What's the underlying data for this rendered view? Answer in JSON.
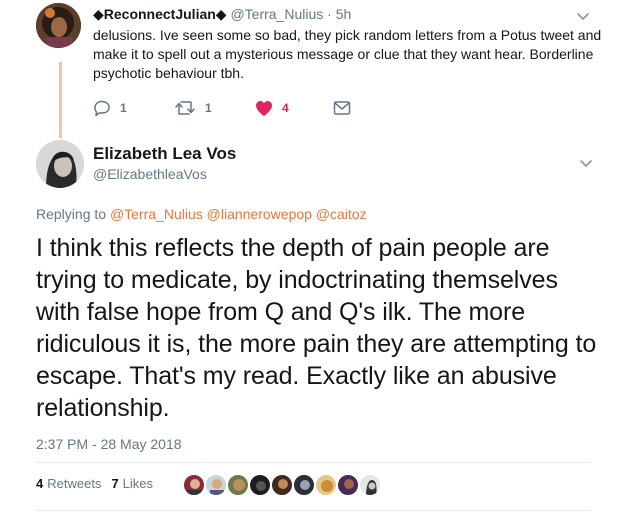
{
  "reply_tweet": {
    "display_name": "◆ReconnectJulian◆",
    "handle": "@Terra_Nulius",
    "time": "· 5h",
    "text": "delusions. Ive seen some so bad, they pick random letters from a Potus tweet and make it to spell out a mysterious message or clue that they want hear. Borderline psychotic behaviour tbh.",
    "replies": "1",
    "retweets": "1",
    "likes": "4",
    "accent_colors": {
      "like": "#e0245e",
      "icon": "#657786",
      "thread": "#f5c2a7"
    }
  },
  "main_tweet": {
    "display_name": "Elizabeth Lea Vos",
    "handle": "@ElizabethleaVos",
    "replying_label": "Replying to",
    "replying_to": [
      "@Terra_Nulius",
      "@liannerowepop",
      "@caitoz"
    ],
    "text": "I think this reflects the depth of pain people are trying to medicate, by indoctrinating themselves with false hope from Q and Q's ilk. The more ridiculous it is, the more pain they are attempting to escape. That's my read. Exactly like an abusive relationship.",
    "timestamp": "2:37 PM - 28 May 2018",
    "retweets_count": "4",
    "retweets_label": "Retweets",
    "likes_count": "7",
    "likes_label": "Likes",
    "mention_color": "#e8763a"
  },
  "icons": {
    "reply": "reply-icon",
    "retweet": "retweet-icon",
    "like": "heart-icon",
    "dm": "envelope-icon",
    "more": "chevron-down-icon"
  }
}
